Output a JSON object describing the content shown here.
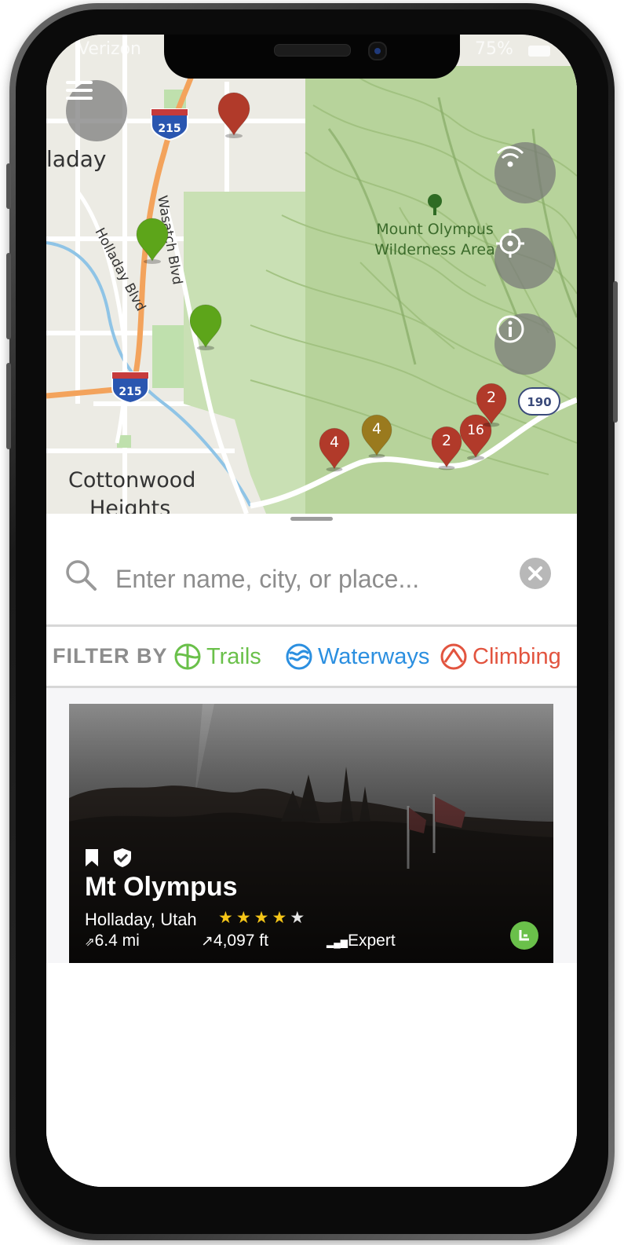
{
  "status_bar": {
    "carrier": "Verizon",
    "battery": "75%"
  },
  "map": {
    "place_labels": {
      "holladay": "laday",
      "cottonwood_line1": "Cottonwood",
      "cottonwood_line2": "Heights",
      "wilderness_line1": "Mount Olympus",
      "wilderness_line2": "Wilderness Area",
      "holladay_blvd": "Holladay Blvd",
      "wasatch_blvd": "Wasatch Blvd"
    },
    "highway_shields": {
      "i215_top": "215",
      "i215_bottom": "215",
      "route190": "190"
    },
    "markers": [
      {
        "kind": "waterway",
        "color": "#b13a2a",
        "count": ""
      },
      {
        "kind": "trail",
        "color": "#5da51a",
        "count": ""
      },
      {
        "kind": "trail",
        "color": "#5da51a",
        "count": ""
      },
      {
        "kind": "cluster",
        "color": "#b13a2a",
        "count": "4"
      },
      {
        "kind": "cluster",
        "color": "#9a7a1e",
        "count": "4"
      },
      {
        "kind": "cluster",
        "color": "#b13a2a",
        "count": "2"
      },
      {
        "kind": "cluster",
        "color": "#b13a2a",
        "count": "16"
      },
      {
        "kind": "cluster",
        "color": "#b13a2a",
        "count": "2"
      }
    ],
    "controls": [
      "menu-icon",
      "signal-icon",
      "locate-icon",
      "info-icon"
    ]
  },
  "search": {
    "placeholder": "Enter name, city, or place...",
    "value": ""
  },
  "filter": {
    "label": "FILTER BY",
    "chips": [
      {
        "label": "Trails",
        "color": "#6ac04a",
        "icon": "trails-icon"
      },
      {
        "label": "Waterways",
        "color": "#2b8fe0",
        "icon": "waterways-icon"
      },
      {
        "label": "Climbing",
        "color": "#e2543f",
        "icon": "climbing-icon"
      }
    ]
  },
  "card": {
    "title": "Mt Olympus",
    "location": "Holladay, Utah",
    "rating": 4,
    "rating_max": 5,
    "distance": "6.4 mi",
    "elevation": "4,097 ft",
    "difficulty": "Expert",
    "icons": [
      "bookmark-icon",
      "verified-shield-icon",
      "trail-type-badge-icon"
    ]
  }
}
